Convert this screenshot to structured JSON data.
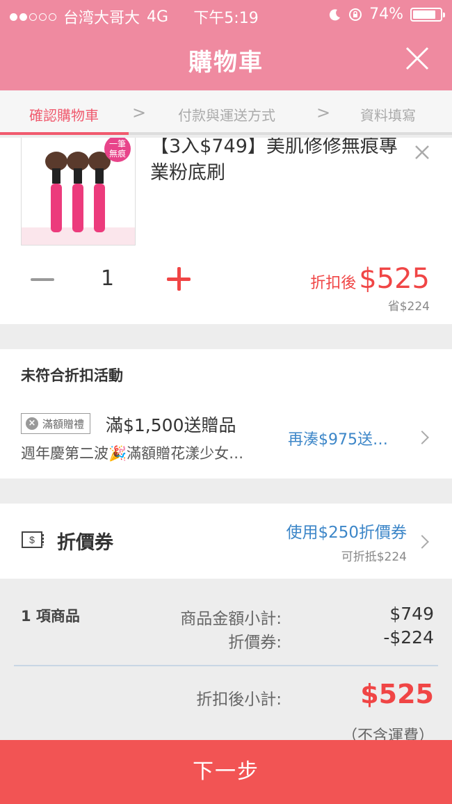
{
  "status_bar": {
    "carrier": "台湾大哥大",
    "network": "4G",
    "time": "下午5:19",
    "battery": "74%"
  },
  "header": {
    "title": "購物車",
    "close_icon": "close-icon"
  },
  "steps": {
    "items": [
      {
        "label": "確認購物車",
        "active": true
      },
      {
        "label": "付款與運送方式",
        "active": false
      },
      {
        "label": "資料填寫",
        "active": false
      }
    ],
    "separator_glyph": ">"
  },
  "product": {
    "name": "【3入$749】美肌修修無痕專業粉底刷",
    "image_badge": "一筆\n無痕",
    "image_badge_lines": [
      "一筆",
      "無痕"
    ],
    "quantity": "1",
    "price_label": "折扣後",
    "price": "$525",
    "saved": "省$224"
  },
  "promotion": {
    "heading": "未符合折扣活動",
    "tag": "滿額贈禮",
    "title": "滿$1,500送贈品",
    "description": "週年慶第二波🎉滿額贈花漾少女…",
    "action": "再湊$975送…"
  },
  "coupon": {
    "label": "折價券",
    "action": "使用$250折價券",
    "sub": "可折抵$224"
  },
  "summary": {
    "item_count": "1 項商品",
    "subtotal_label": "商品金額小計:",
    "subtotal_value": "$749",
    "coupon_label": "折價券:",
    "coupon_value": "-$224",
    "total_label": "折扣後小計:",
    "total_value": "$525",
    "shipping_note": "（不含運費）"
  },
  "footer": {
    "next_label": "下一步"
  },
  "colors": {
    "header_pink": "#ef8aa0",
    "accent_red": "#f04545",
    "link_blue": "#3c86c8",
    "step_active": "#f05a6e"
  }
}
